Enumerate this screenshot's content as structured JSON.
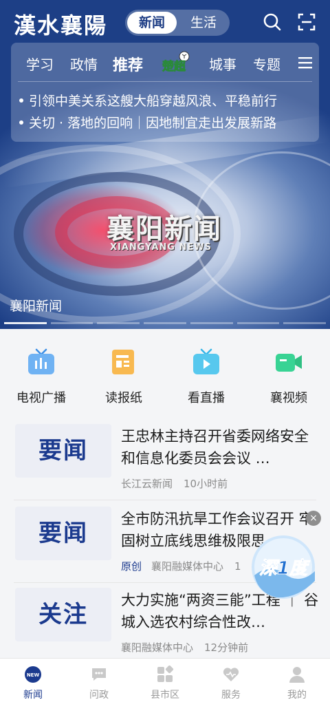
{
  "app": {
    "logo_text": "漢水襄陽"
  },
  "header": {
    "segments": [
      {
        "label": "新闻",
        "active": true
      },
      {
        "label": "生活",
        "active": false
      }
    ],
    "icons": [
      "search-icon",
      "scan-icon"
    ]
  },
  "channels": {
    "tabs": [
      {
        "label": "学习"
      },
      {
        "label": "政情"
      },
      {
        "label": "推荐",
        "active": true
      },
      {
        "label": "楚超",
        "badge": true
      },
      {
        "label": "城事"
      },
      {
        "label": "专题"
      }
    ],
    "headlines": [
      "引领中美关系这艘大船穿越风浪、平稳前行",
      "关切 · 落地的回响｜因地制宜走出发展新路"
    ]
  },
  "hero": {
    "logo_cn": "襄阳新闻",
    "logo_en": "XIANGYANG NEWS",
    "caption": "襄阳新闻",
    "slides": 7,
    "active_slide": 0
  },
  "services": [
    {
      "label": "电视广播",
      "icon": "tv-broadcast-icon",
      "color": "#3a8ee6"
    },
    {
      "label": "读报纸",
      "icon": "newspaper-icon",
      "color": "#f4a93b"
    },
    {
      "label": "看直播",
      "icon": "live-play-icon",
      "color": "#34b5e8"
    },
    {
      "label": "襄视频",
      "icon": "video-camera-icon",
      "color": "#2fcf8c"
    }
  ],
  "news": [
    {
      "thumb": "要闻",
      "title": "王忠林主持召开省委网络安全和信息化委员会会议 …",
      "tag": "",
      "source": "长江云新闻",
      "time": "10小时前"
    },
    {
      "thumb": "要闻",
      "title": "全市防汛抗旱工作会议召开 牢固树立底线思维极限思…",
      "tag": "原创",
      "source": "襄阳融媒体中心",
      "time": "1"
    },
    {
      "thumb": "关注",
      "title": "大力实施“两资三能”工程 ｜ 谷城入选农村综合性改…",
      "tag": "",
      "source": "襄阳融媒体中心",
      "time": "12分钟前"
    }
  ],
  "float_badge": {
    "text": "深1度",
    "close": "×"
  },
  "bottom_nav": [
    {
      "label": "新闻",
      "icon": "news-icon",
      "active": true
    },
    {
      "label": "问政",
      "icon": "chat-icon"
    },
    {
      "label": "县市区",
      "icon": "grid-icon"
    },
    {
      "label": "服务",
      "icon": "service-heart-icon"
    },
    {
      "label": "我的",
      "icon": "user-icon"
    }
  ],
  "colors": {
    "brand": "#1b3a8e",
    "header_bg": "#1d3f86"
  }
}
